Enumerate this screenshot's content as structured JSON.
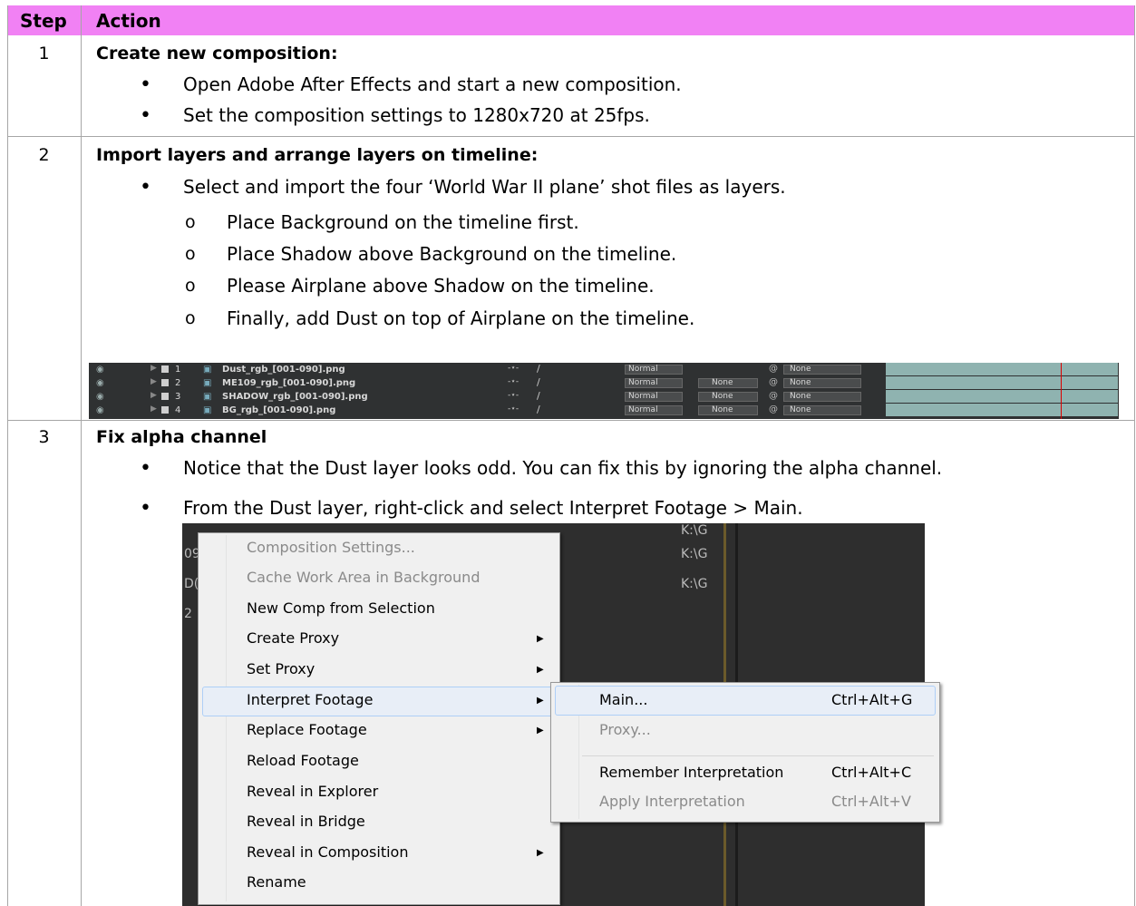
{
  "header": {
    "step": "Step",
    "action": "Action"
  },
  "steps": [
    {
      "number": "1",
      "title": "Create new composition:",
      "bullets": [
        "Open Adobe After Effects and start a new composition.",
        "Set the composition settings to 1280x720 at 25fps."
      ]
    },
    {
      "number": "2",
      "title": "Import layers and arrange layers on timeline:",
      "bullets": [
        "Select and import the four ‘World War II plane’ shot files as layers."
      ],
      "subbullets": [
        "Place Background on the timeline first.",
        "Place Shadow above Background on the timeline.",
        "Please Airplane above Shadow on the timeline.",
        "Finally, add Dust on top of Airplane on the timeline."
      ]
    },
    {
      "number": "3",
      "title": "Fix alpha channel",
      "bullets": [
        "Notice that the Dust layer looks odd. You can fix this by ignoring the alpha channel.",
        "From the Dust layer, right-click and select Interpret Footage > Main."
      ]
    }
  ],
  "timeline": {
    "layers": [
      {
        "num": "1",
        "name": "Dust_rgb_[001-090].png",
        "mode": "Normal",
        "trkmat": "",
        "parent": "None"
      },
      {
        "num": "2",
        "name": "ME109_rgb_[001-090].png",
        "mode": "Normal",
        "trkmat": "None",
        "parent": "None"
      },
      {
        "num": "3",
        "name": "SHADOW_rgb_[001-090].png",
        "mode": "Normal",
        "trkmat": "None",
        "parent": "None"
      },
      {
        "num": "4",
        "name": "BG_rgb_[001-090].png",
        "mode": "Normal",
        "trkmat": "None",
        "parent": "None"
      }
    ]
  },
  "background_fragments": {
    "paths": [
      "K:\\G",
      "K:\\G",
      "K:\\G"
    ],
    "left": [
      "09",
      "D(",
      "2"
    ]
  },
  "context_menu": {
    "items": [
      {
        "label": "Composition Settings...",
        "disabled": true,
        "submenu": false
      },
      {
        "label": "Cache Work Area in Background",
        "disabled": true,
        "submenu": false
      },
      {
        "label": "New Comp from Selection",
        "disabled": false,
        "submenu": false
      },
      {
        "label": "Create Proxy",
        "disabled": false,
        "submenu": true
      },
      {
        "label": "Set Proxy",
        "disabled": false,
        "submenu": true
      },
      {
        "label": "Interpret Footage",
        "disabled": false,
        "submenu": true,
        "highlighted": true
      },
      {
        "label": "Replace Footage",
        "disabled": false,
        "submenu": true
      },
      {
        "label": "Reload Footage",
        "disabled": false,
        "submenu": false
      },
      {
        "label": "Reveal in Explorer",
        "disabled": false,
        "submenu": false
      },
      {
        "label": "Reveal in Bridge",
        "disabled": false,
        "submenu": false
      },
      {
        "label": "Reveal in Composition",
        "disabled": false,
        "submenu": true
      },
      {
        "label": "Rename",
        "disabled": false,
        "submenu": false
      }
    ]
  },
  "submenu": {
    "items": [
      {
        "label": "Main...",
        "shortcut": "Ctrl+Alt+G",
        "disabled": false,
        "highlighted": true
      },
      {
        "label": "Proxy...",
        "shortcut": "",
        "disabled": true
      },
      {
        "label": "Remember Interpretation",
        "shortcut": "Ctrl+Alt+C",
        "disabled": false
      },
      {
        "label": "Apply Interpretation",
        "shortcut": "Ctrl+Alt+V",
        "disabled": true
      }
    ]
  }
}
